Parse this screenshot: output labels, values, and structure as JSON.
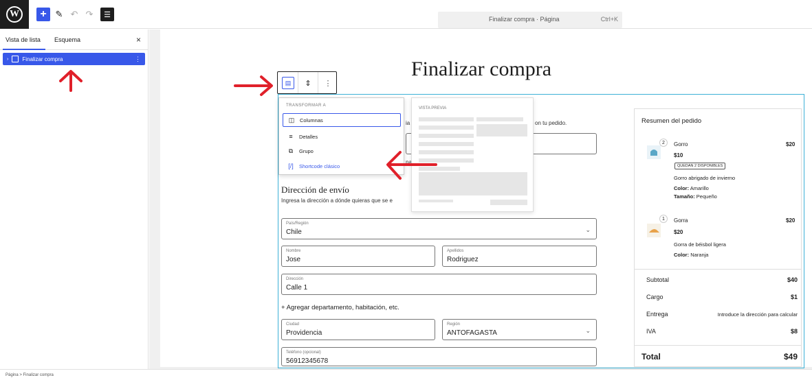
{
  "topbar": {
    "logo_letter": "W",
    "add_icon": "plus-icon",
    "pen_icon": "pen-icon",
    "undo_icon": "undo-icon",
    "redo_icon": "redo-icon",
    "list_view_icon": "list-view-icon",
    "command_title": "Finalizar compra · Página",
    "command_shortcut": "Ctrl+K"
  },
  "sidebar": {
    "tabs": [
      {
        "label": "Vista de lista"
      },
      {
        "label": "Esquema"
      }
    ],
    "close_label": "×",
    "item_label": "Finalizar compra"
  },
  "page": {
    "title": "Finalizar compra"
  },
  "transform_menu": {
    "header": "TRANSFORMAR A",
    "items": [
      {
        "label": "Columnas",
        "icon": "columns-icon"
      },
      {
        "label": "Detalles",
        "icon": "details-icon"
      },
      {
        "label": "Grupo",
        "icon": "group-icon"
      },
      {
        "label": "Shortcode clásico",
        "icon": "shortcode-icon"
      }
    ]
  },
  "preview": {
    "header": "VISTA PREVIA"
  },
  "checkout_form": {
    "fragment_top": "on tu pedido.",
    "fragment_left": "ia",
    "fragment_mid": "pa",
    "shipping_heading": "Dirección de envío",
    "shipping_desc": "Ingresa la dirección a dónde quieras que se e",
    "country": {
      "label": "País/Región",
      "value": "Chile"
    },
    "first_name": {
      "label": "Nombre",
      "value": "Jose"
    },
    "last_name": {
      "label": "Apellidos",
      "value": "Rodriguez"
    },
    "address": {
      "label": "Dirección",
      "value": "Calle 1"
    },
    "add_apartment": "+ Agregar departamento, habitación, etc.",
    "city": {
      "label": "Ciudad",
      "value": "Providencia"
    },
    "region": {
      "label": "Región",
      "value": "ANTOFAGASTA"
    },
    "phone": {
      "label": "Teléfono (opcional)",
      "value": "56912345678"
    }
  },
  "order_summary": {
    "title": "Resumen del pedido",
    "items": [
      {
        "qty": "2",
        "name": "Gorro",
        "total": "$20",
        "price": "$10",
        "badge": "QUEDAN 2 DISPONIBLES",
        "desc": "Gorro abrigado de invierno",
        "attr1_label": "Color:",
        "attr1_value": "Amarillo",
        "attr2_label": "Tamaño:",
        "attr2_value": "Pequeño"
      },
      {
        "qty": "1",
        "name": "Gorra",
        "total": "$20",
        "price": "$20",
        "desc": "Gorra de béisbol ligera",
        "attr1_label": "Color:",
        "attr1_value": "Naranja"
      }
    ],
    "subtotal_label": "Subtotal",
    "subtotal_value": "$40",
    "shipping_label": "Cargo",
    "shipping_value": "$1",
    "delivery_label": "Entrega",
    "delivery_value": "Introduce la dirección para calcular",
    "tax_label": "IVA",
    "tax_value": "$8",
    "total_label": "Total",
    "total_value": "$49"
  },
  "statusbar": {
    "breadcrumb": "Página  >  Finalizar compra"
  },
  "colors": {
    "accent": "#3858e9",
    "block_outline": "#3bb0d6",
    "annotation_arrow": "#e0202a"
  }
}
